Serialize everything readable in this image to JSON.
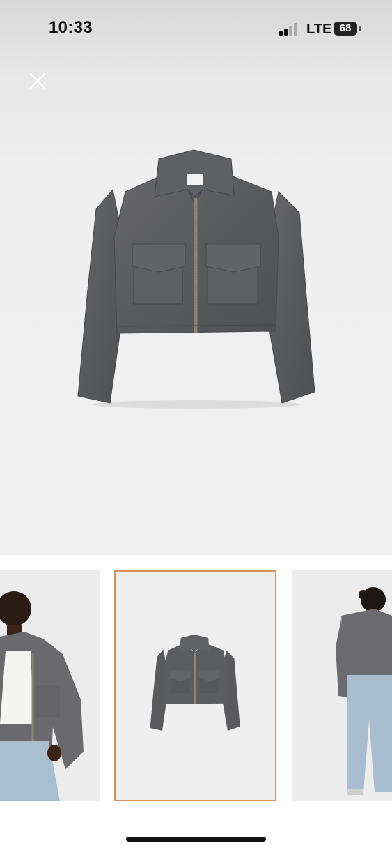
{
  "status_bar": {
    "time": "10:33",
    "network": "LTE",
    "battery": "68"
  },
  "icons": {
    "close": "close-icon",
    "signal": "cellular-signal-icon"
  },
  "gallery": {
    "selected_index": 1,
    "thumbnails": [
      {
        "name": "model-front"
      },
      {
        "name": "jacket-product"
      },
      {
        "name": "model-back"
      }
    ]
  },
  "colors": {
    "background_top": "#d8d8d8",
    "background": "#f0f0f0",
    "jacket": "#5b5b5d",
    "selected_border": "#d4935a"
  }
}
